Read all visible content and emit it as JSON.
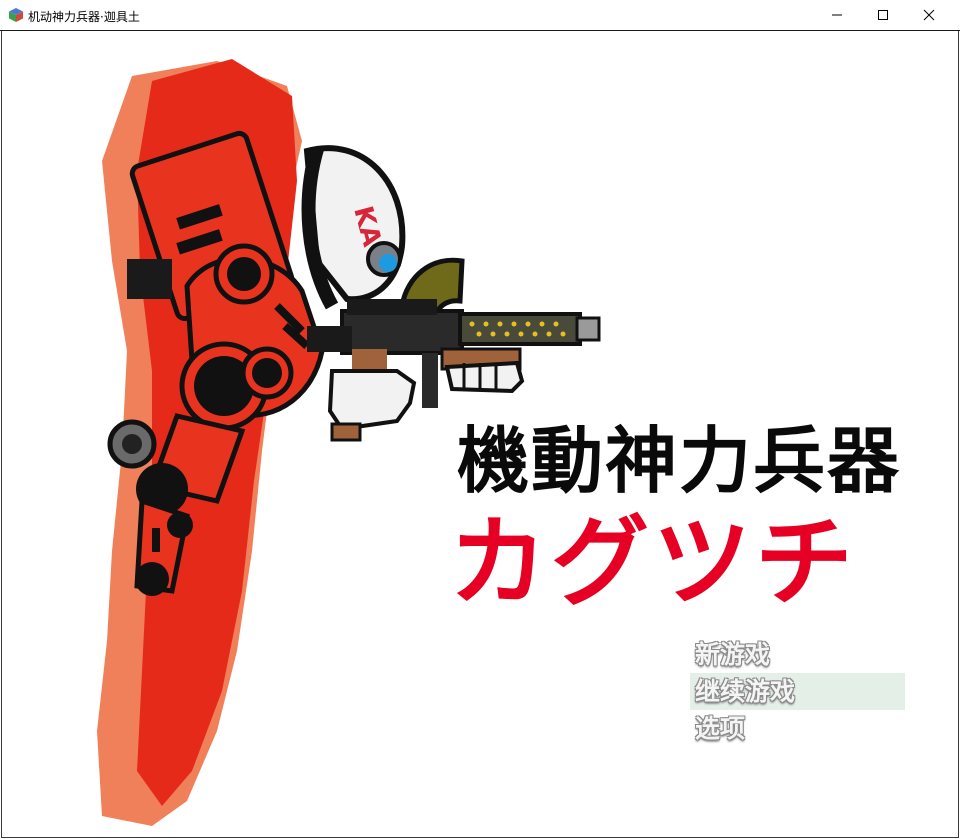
{
  "window": {
    "title": "机动神力兵器·迦具土",
    "controls": [
      "minimize-icon",
      "maximize-icon",
      "close-icon"
    ]
  },
  "logo": {
    "title_kanji": "機動神力兵器",
    "title_kana": "カグツチ",
    "title_color": "#0a0a0a",
    "kana_color": "#e60024"
  },
  "helmet_text": "KAG",
  "menu": {
    "items": [
      {
        "label": "新游戏",
        "selected": false
      },
      {
        "label": "继续游戏",
        "selected": true
      },
      {
        "label": "选项",
        "selected": false
      }
    ],
    "highlight_color": "#dcebe0"
  },
  "colors": {
    "splash_red": "#e62a1a",
    "splash_salmon": "#f0805a",
    "armor_red": "#e8341e",
    "gun_dark": "#2a2a2a"
  }
}
